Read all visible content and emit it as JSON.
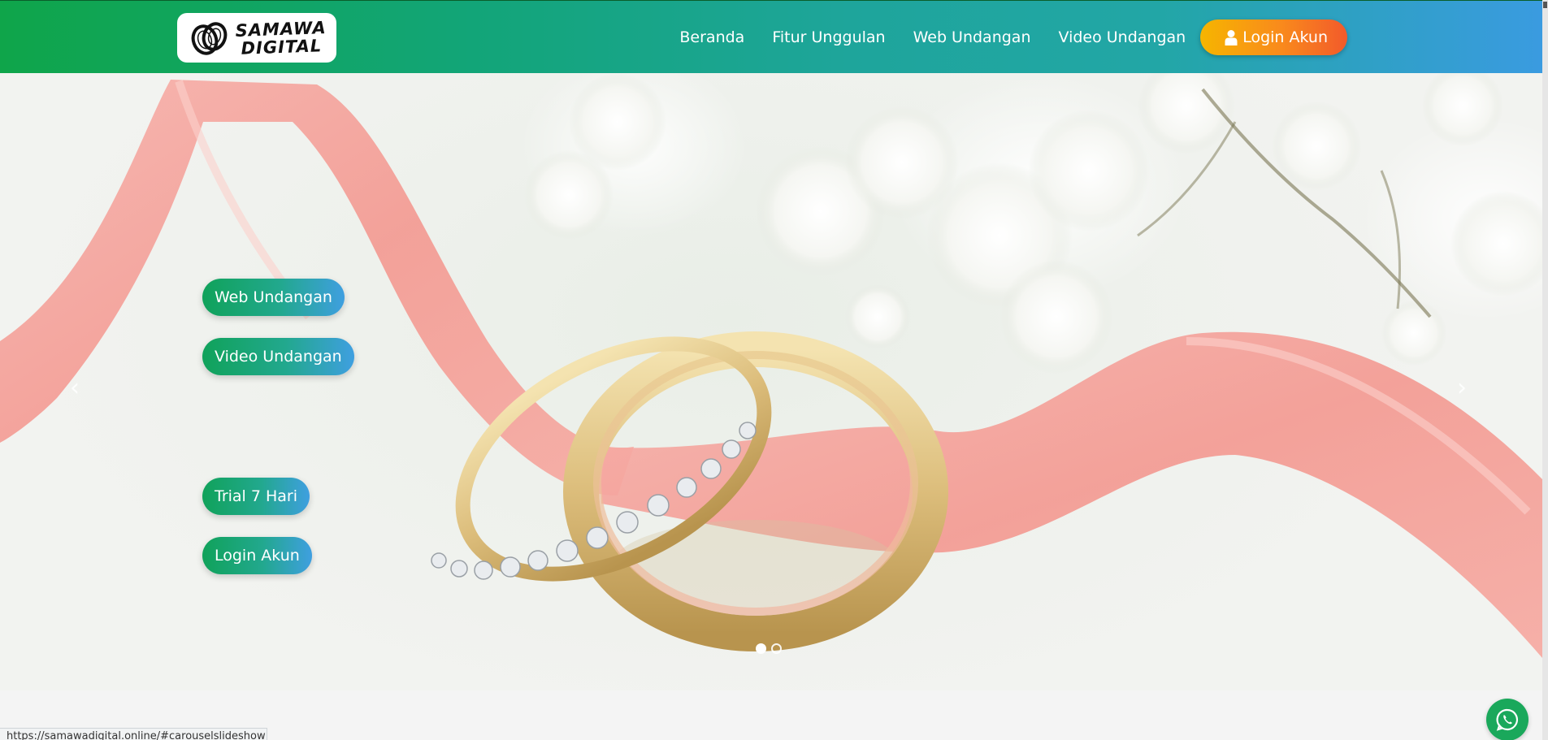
{
  "brand": {
    "logo_line1": "SAMAWA",
    "logo_line2": "DIGITAL",
    "primary_color": "#12a56c",
    "accent_color": "#3a9be0",
    "login_gradient": "#f6b500"
  },
  "nav": {
    "items": [
      {
        "label": "Beranda"
      },
      {
        "label": "Fitur Unggulan"
      },
      {
        "label": "Web Undangan"
      },
      {
        "label": "Video Undangan"
      }
    ],
    "login_label": "Login Akun",
    "login_icon": "user-icon"
  },
  "hero": {
    "buttons": [
      {
        "label": "Web Undangan"
      },
      {
        "label": "Video Undangan"
      },
      {
        "label": "Trial 7 Hari"
      },
      {
        "label": "Login Akun"
      }
    ],
    "prev_arrow": "‹",
    "next_arrow": "›",
    "slide_count": 2,
    "active_slide": 1
  },
  "status_bar": {
    "url": "https://samawadigital.online/#carouselslideshow"
  },
  "floating": {
    "whatsapp_icon": "whatsapp-icon"
  }
}
